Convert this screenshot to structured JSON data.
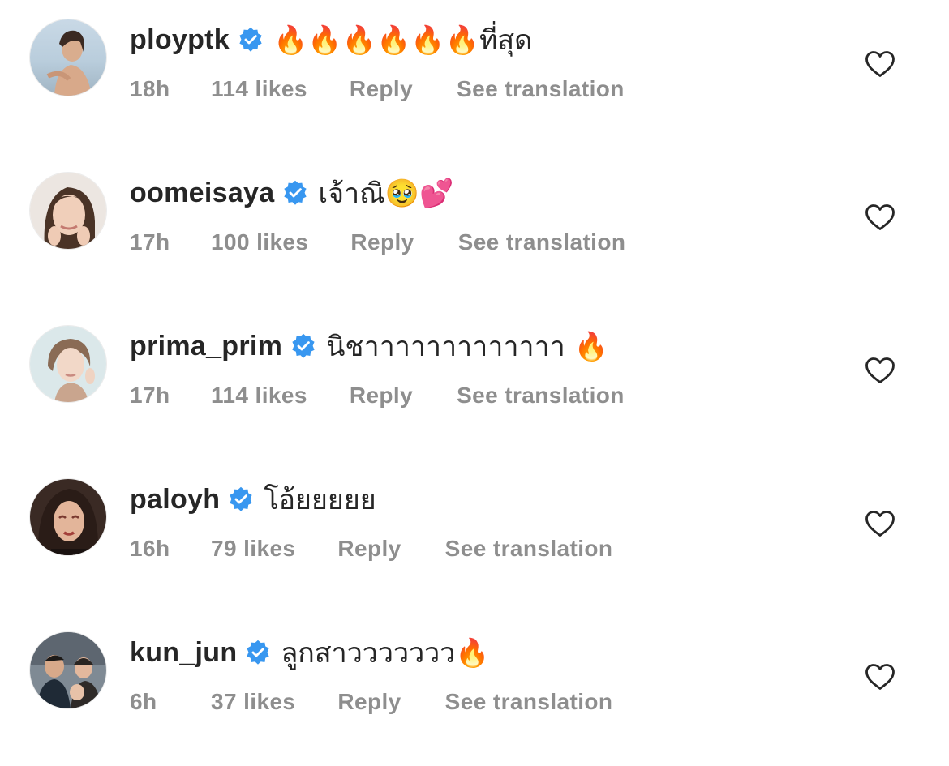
{
  "comments": [
    {
      "username": "ployptk",
      "text": "🔥🔥🔥🔥🔥🔥ที่สุด",
      "time": "18h",
      "likes": "114 likes",
      "reply": "Reply",
      "translate": "See translation"
    },
    {
      "username": "oomeisaya",
      "text": "เจ้าณิ🥹💕",
      "time": "17h",
      "likes": "100 likes",
      "reply": "Reply",
      "translate": "See translation"
    },
    {
      "username": "prima_prim",
      "text": "นิชาาาาาาาาาาาาา 🔥",
      "time": "17h",
      "likes": "114 likes",
      "reply": "Reply",
      "translate": "See translation"
    },
    {
      "username": "paloyh",
      "text": "โอ้ยยยยย",
      "time": "16h",
      "likes": "79 likes",
      "reply": "Reply",
      "translate": "See translation"
    },
    {
      "username": "kun_jun",
      "text": "ลูกสาววววววว🔥",
      "time": "6h",
      "likes": "37 likes",
      "reply": "Reply",
      "translate": "See translation"
    }
  ],
  "icons": {
    "verified": "verified-badge-icon",
    "like": "heart-outline-icon"
  },
  "colors": {
    "username": "#262626",
    "meta": "#8e8e8e",
    "verified": "#3897f0"
  }
}
